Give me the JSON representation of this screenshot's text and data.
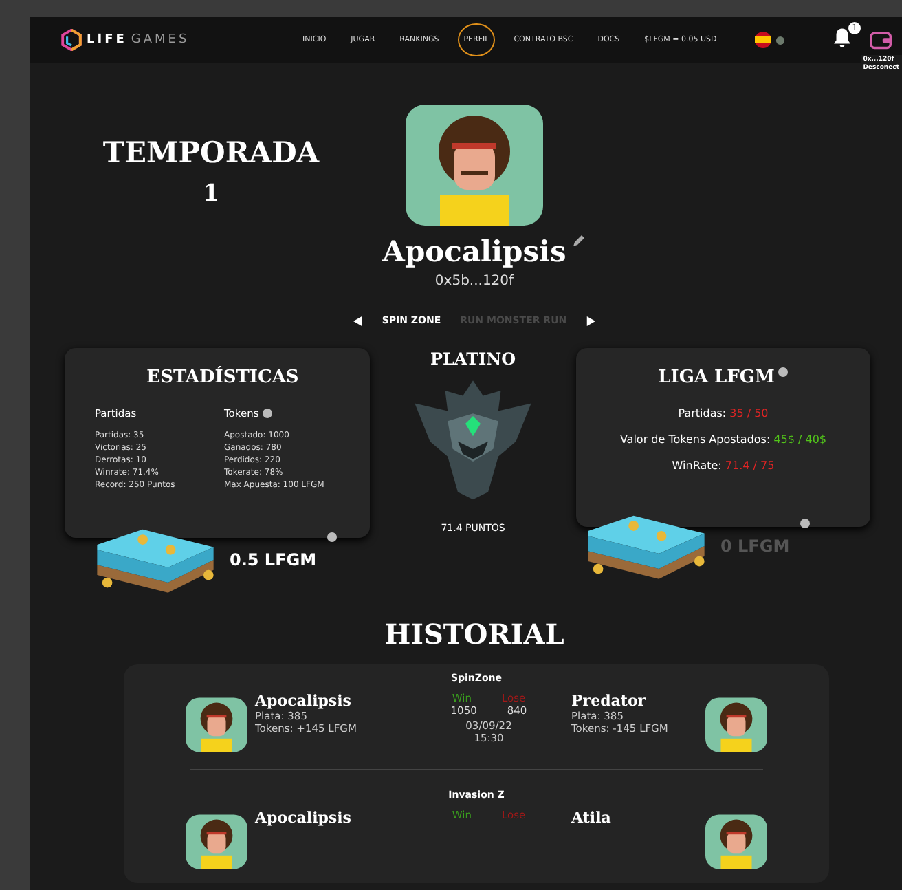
{
  "nav": {
    "brand": [
      "LIFE",
      "GAMES"
    ],
    "items": [
      {
        "label": "INICIO",
        "selected": false
      },
      {
        "label": "JUGAR",
        "selected": false
      },
      {
        "label": "RANKINGS",
        "selected": false
      },
      {
        "label": "PERFIL",
        "selected": true
      },
      {
        "label": "CONTRATO BSC",
        "selected": false
      },
      {
        "label": "DOCS",
        "selected": false
      },
      {
        "label": "$LFGM = 0.05 USD",
        "selected": false
      }
    ],
    "notifications": "1",
    "wallet_menu": [
      "0x...120f",
      "Desconect"
    ]
  },
  "profile": {
    "season_label": "TEMPORADA",
    "season_number": "1",
    "name": "Apocalipsis",
    "address": "0x5b...120f",
    "games": [
      {
        "label": "SPIN ZONE",
        "selected": true
      },
      {
        "label": "RUN MONSTER RUN",
        "selected": false
      }
    ]
  },
  "stats": {
    "title": "ESTADÍSTICAS",
    "columns": [
      {
        "heading": "Partidas",
        "info": false,
        "lines": [
          "Partidas: 35",
          "Victorias: 25",
          "Derrotas: 10",
          "Winrate: 71.4%",
          "Record: 250 Puntos"
        ]
      },
      {
        "heading": "Tokens",
        "info": true,
        "lines": [
          "Apostado: 1000",
          "Ganados: 780",
          "Perdidos: 220",
          "Tokerate: 78%",
          "Max Apuesta: 100 LFGM"
        ]
      }
    ]
  },
  "rank": {
    "tier": "PLATINO",
    "points": "71.4 PUNTOS"
  },
  "league": {
    "title": "LIGA LFGM",
    "rows": [
      {
        "label": "Partidas:",
        "value": "35 / 50",
        "color": "#e02424"
      },
      {
        "label": "Valor de Tokens Apostados:",
        "value": "45$ / 40$",
        "color": "#52c41a"
      },
      {
        "label": "WinRate:",
        "value": "71.4 / 75",
        "color": "#e02424"
      }
    ]
  },
  "balances": [
    {
      "amount": "0.5 LFGM",
      "dimmed": false
    },
    {
      "amount": "0 LFGM",
      "dimmed": true
    }
  ],
  "history": {
    "title": "HISTORIAL",
    "matches": [
      {
        "game": "SpinZone",
        "player": {
          "name": "Apocalipsis",
          "lines": [
            "Plata: 385",
            "Tokens: +145 LFGM"
          ]
        },
        "opponent": {
          "name": "Predator",
          "lines": [
            "Plata: 385",
            "Tokens: -145 LFGM"
          ]
        },
        "win_label": "Win",
        "lose_label": "Lose",
        "scores": [
          "1050",
          "840"
        ],
        "when": [
          "03/09/22",
          "15:30"
        ]
      },
      {
        "game": "Invasion Z",
        "player": {
          "name": "Apocalipsis"
        },
        "opponent": {
          "name": "Atila"
        },
        "win_label": "Win",
        "lose_label": "Lose"
      }
    ]
  }
}
